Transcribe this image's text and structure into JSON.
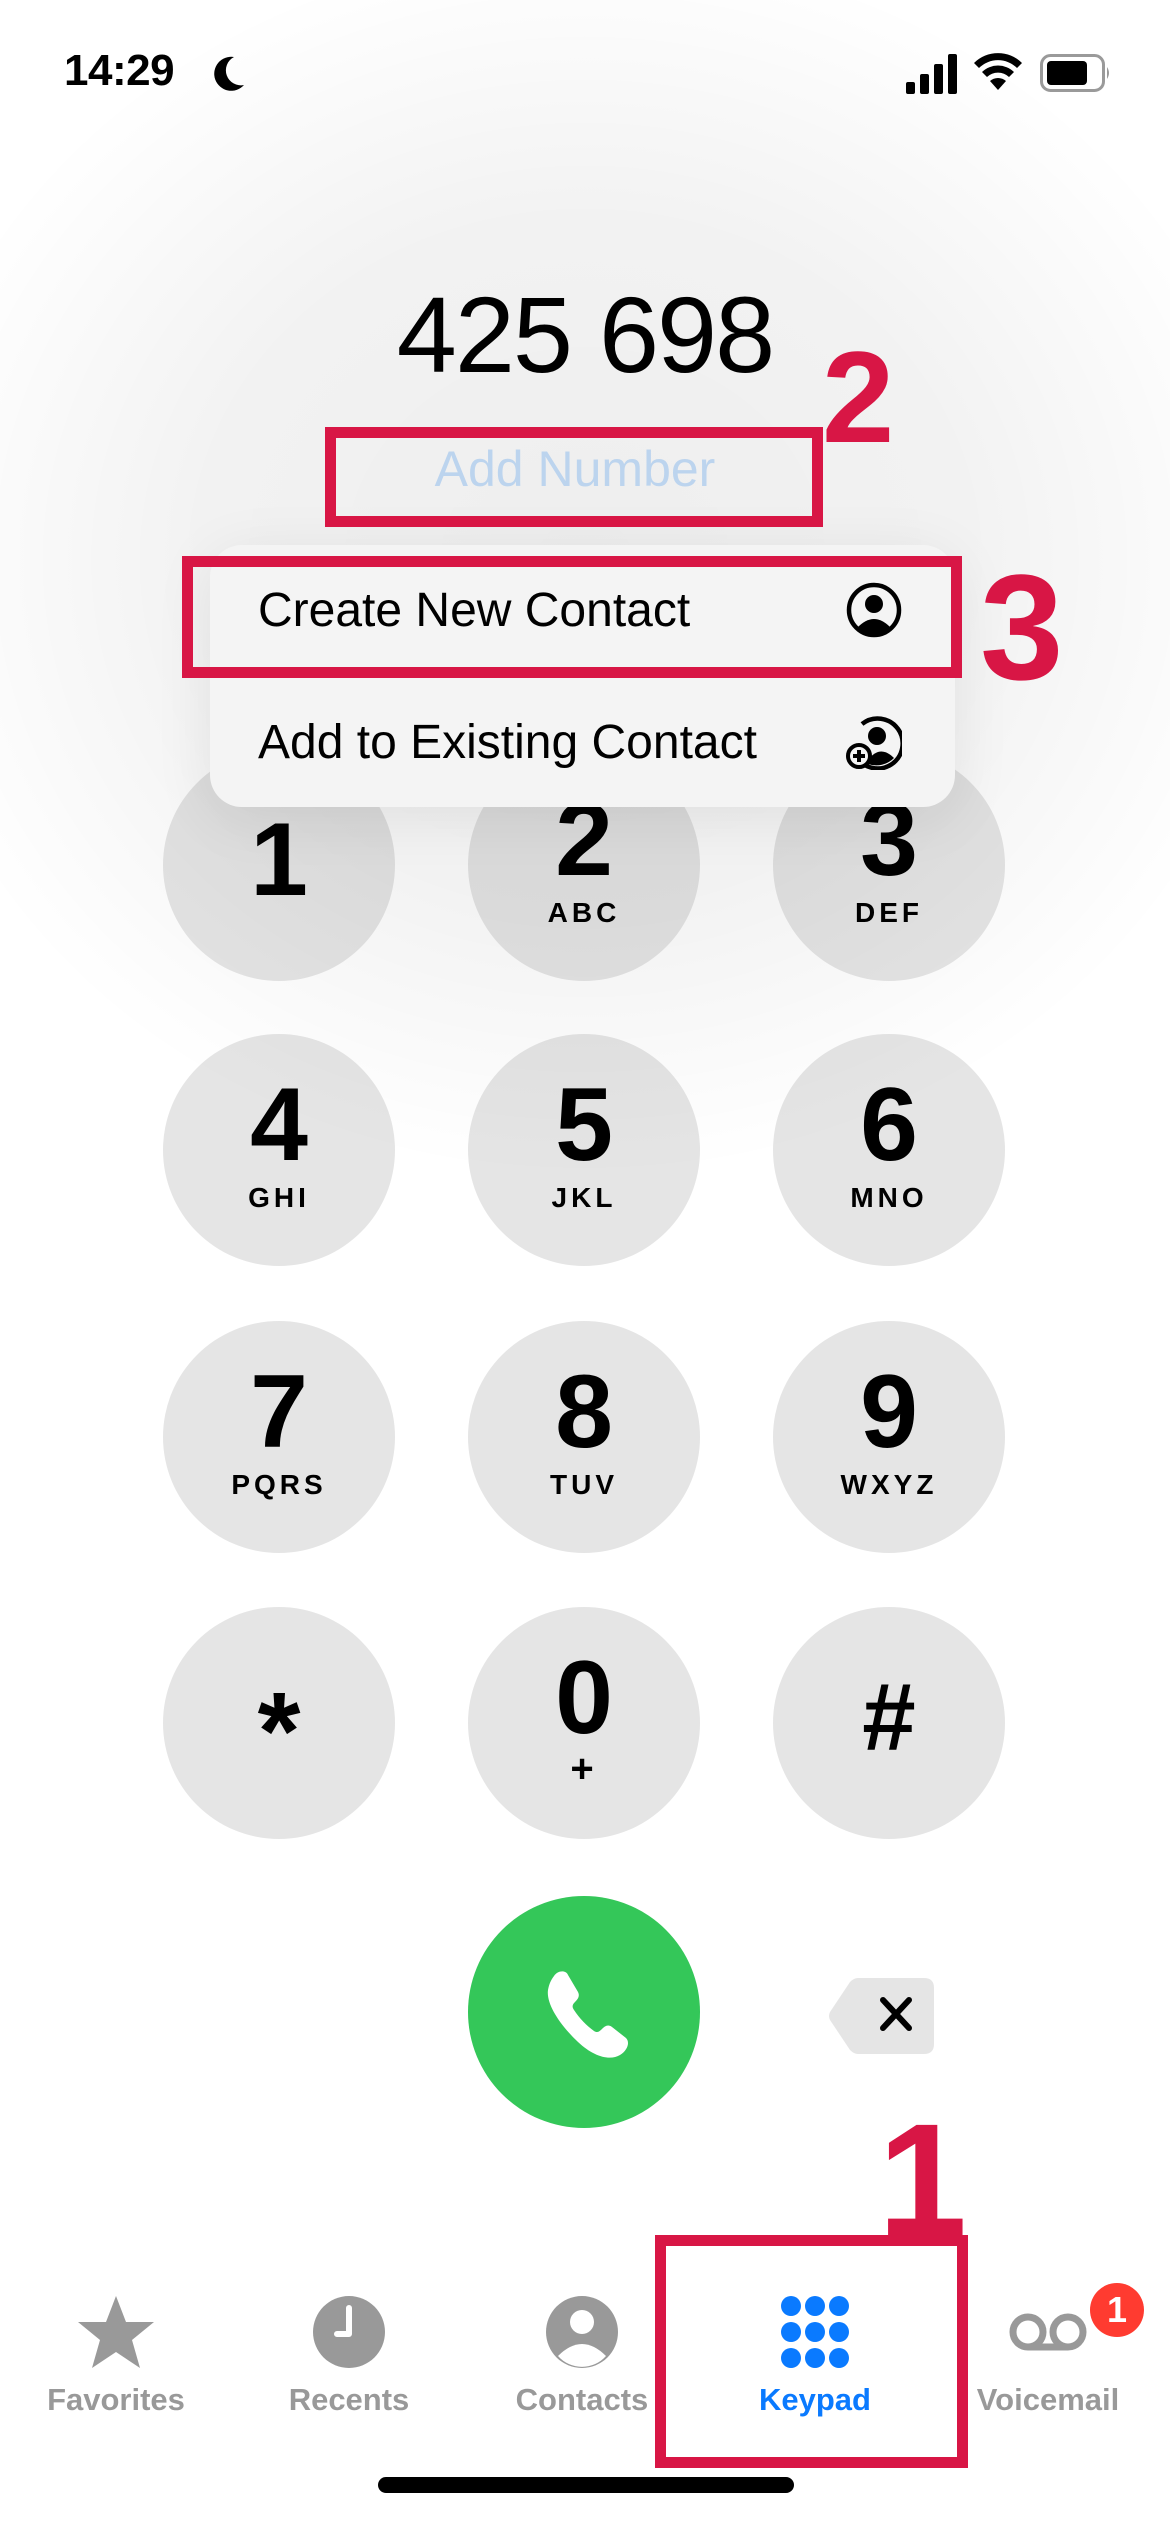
{
  "status_bar": {
    "time": "14:29",
    "focus_icon": "moon-icon",
    "signal_icon": "cellular-signal-icon",
    "wifi_icon": "wifi-icon",
    "battery_icon": "battery-icon"
  },
  "dialer": {
    "dialed_number": "425 698",
    "add_number_label": "Add Number"
  },
  "menu": {
    "items": [
      {
        "label": "Create New Contact",
        "icon": "person-circle-icon"
      },
      {
        "label": "Add to Existing Contact",
        "icon": "person-add-icon"
      }
    ]
  },
  "keypad": {
    "keys": [
      {
        "digit": "1",
        "letters": ""
      },
      {
        "digit": "2",
        "letters": "ABC"
      },
      {
        "digit": "3",
        "letters": "DEF"
      },
      {
        "digit": "4",
        "letters": "GHI"
      },
      {
        "digit": "5",
        "letters": "JKL"
      },
      {
        "digit": "6",
        "letters": "MNO"
      },
      {
        "digit": "7",
        "letters": "PQRS"
      },
      {
        "digit": "8",
        "letters": "TUV"
      },
      {
        "digit": "9",
        "letters": "WXYZ"
      },
      {
        "digit": "*",
        "letters": ""
      },
      {
        "digit": "0",
        "letters": "+"
      },
      {
        "digit": "#",
        "letters": ""
      }
    ],
    "call_icon": "phone-icon",
    "delete_icon": "delete-backspace-icon"
  },
  "tab_bar": {
    "tabs": [
      {
        "label": "Favorites",
        "icon": "star-icon",
        "active": false
      },
      {
        "label": "Recents",
        "icon": "clock-icon",
        "active": false
      },
      {
        "label": "Contacts",
        "icon": "person-circle-icon",
        "active": false
      },
      {
        "label": "Keypad",
        "icon": "keypad-grid-icon",
        "active": true
      },
      {
        "label": "Voicemail",
        "icon": "voicemail-icon",
        "active": false
      }
    ],
    "voicemail_badge": "1"
  },
  "annotations": {
    "step_1": "1",
    "step_2": "2",
    "step_3": "3",
    "color": "#d81645"
  },
  "colors": {
    "accent_blue": "#0a7aff",
    "call_green": "#34c759",
    "badge_red": "#ff3b30",
    "key_gray": "#e5e5e5",
    "add_number_text": "#bcd4ee"
  }
}
